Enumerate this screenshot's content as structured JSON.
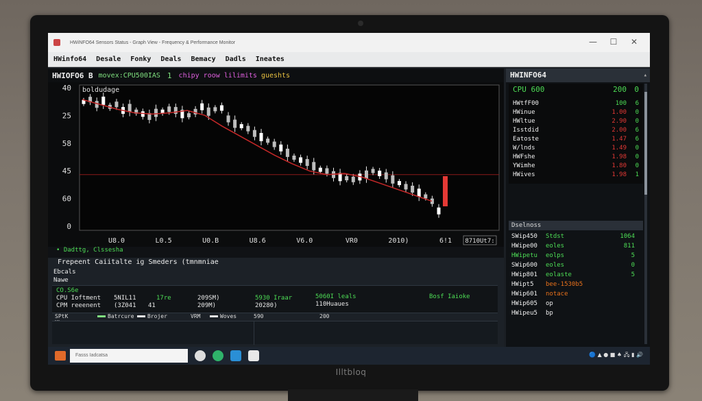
{
  "window": {
    "title": "HWiNFO64 Sensors Status - Graph View - Frequency & Performance Monitor",
    "controls": [
      "—",
      "☐",
      "✕"
    ]
  },
  "menu": [
    "HWinfo64",
    "Desale",
    "Fonky",
    "Deals",
    "Bemacy",
    "Dadls",
    "Ineates"
  ],
  "chart_header": {
    "title": "HWIOFO6 B",
    "legend": "movex:CPU500IAS",
    "count": "1",
    "series_m": "chipy roow lilimits",
    "series_y": "gueshts"
  },
  "chart_data": {
    "type": "line",
    "title": "",
    "ylabel": "",
    "xlabel": "",
    "inner_label": "boldudage",
    "y_ticks": [
      "40",
      "25",
      "58",
      "45",
      "60",
      "0"
    ],
    "x_ticks": [
      "U8.0",
      "L0.5",
      "U0.B",
      "U8.6",
      "V6.0",
      "VR0",
      "2010)",
      "6!1"
    ],
    "cursor_value": "8710Ut7:",
    "ylim": [
      0,
      6
    ],
    "reference_level": 2.3,
    "series": [
      {
        "name": "",
        "type": "candlestick",
        "color": "#e8e8e8",
        "values": [
          5.3,
          5.4,
          5.2,
          5.35,
          5.1,
          5.2,
          4.95,
          5.05,
          4.9,
          4.8,
          4.7,
          4.85,
          4.9,
          5.0,
          4.95,
          4.8,
          4.75,
          4.9,
          5.1,
          4.9,
          5.0,
          5.05,
          4.6,
          4.4,
          4.3,
          4.2,
          4.0,
          3.85,
          3.7,
          3.55,
          3.4,
          3.2,
          3.0,
          2.9,
          2.8,
          2.65,
          2.5,
          2.45,
          2.3,
          2.2,
          2.15,
          2.1,
          2.2,
          2.3,
          2.45,
          2.35,
          2.25,
          2.1,
          1.95,
          1.8,
          1.7,
          1.55,
          1.4,
          1.2,
          0.8
        ]
      },
      {
        "name": "",
        "type": "line",
        "color": "#c62828",
        "values": [
          5.4,
          5.2,
          5.0,
          4.85,
          4.8,
          4.85,
          4.95,
          4.75,
          4.3,
          3.9,
          3.5,
          3.1,
          2.75,
          2.45,
          2.3,
          2.35,
          2.2,
          1.95,
          1.7,
          1.45,
          1.2
        ]
      }
    ],
    "marker_value": 1.5,
    "grid": false,
    "legend": "bottom-left"
  },
  "chart_legend": "• Dadttg, Clssesha",
  "bottom_panel": {
    "title": "Frepeent Caiitalte ig Smeders (tmnmniae",
    "row1": "Ebcals",
    "row2": "Nawe",
    "cells": [
      {
        "text": "CO.S6e",
        "tone": "green"
      },
      {
        "text": "CPU Ioftment",
        "tone": "white"
      },
      {
        "text": "CPM reeenent",
        "tone": "white"
      },
      {
        "text": "5NIL11",
        "tone": "white"
      },
      {
        "text": "(3Z041",
        "tone": "white"
      },
      {
        "text": "17re",
        "tone": "green"
      },
      {
        "text": "41",
        "tone": "white"
      },
      {
        "text": "209SM)",
        "tone": "white"
      },
      {
        "text": "209M)",
        "tone": "white"
      },
      {
        "text": "5930 Iraar",
        "tone": "green"
      },
      {
        "text": "20280)",
        "tone": "white"
      },
      {
        "text": "5060I leals",
        "tone": "green"
      },
      {
        "text": "110Huaues",
        "tone": "white"
      },
      {
        "text": "Bosf Iaioke",
        "tone": "green"
      }
    ],
    "legend": [
      {
        "text": "SPtK Ubo",
        "swatch": ""
      },
      {
        "text": "Batrcure",
        "swatch": "#7fe07f"
      },
      {
        "text": "Brojer",
        "swatch": "#e8e8e8"
      },
      {
        "text": "VRM",
        "swatch": ""
      },
      {
        "text": "Woves",
        "swatch": "#e8e8e8"
      },
      {
        "text": "590",
        "swatch": ""
      },
      {
        "text": "200",
        "swatch": ""
      }
    ]
  },
  "right_panel": {
    "title": "HWINFO64",
    "sensors": [
      {
        "label": "CPU 600",
        "value": "200",
        "status": "0",
        "value_color": "#4ddd55",
        "big": true
      },
      {
        "label": "HWtfF00",
        "value": "100",
        "status": "6",
        "value_color": "#4ddd55"
      },
      {
        "label": "HWinue",
        "value": "1.00",
        "status": "0",
        "value_color": "#e53935"
      },
      {
        "label": "HWltue",
        "value": "2.90",
        "status": "0",
        "value_color": "#e53935"
      },
      {
        "label": "Isstdid",
        "value": "2.00",
        "status": "6",
        "value_color": "#e53935"
      },
      {
        "label": "Eatoste",
        "value": "1.47",
        "status": "6",
        "value_color": "#e53935"
      },
      {
        "label": "W/lnds",
        "value": "1.49",
        "status": "0",
        "value_color": "#e53935"
      },
      {
        "label": "HWFshe",
        "value": "1.98",
        "status": "0",
        "value_color": "#e53935"
      },
      {
        "label": "YWimhe",
        "value": "1.80",
        "status": "0",
        "value_color": "#e53935"
      },
      {
        "label": "HWives",
        "value": "1.98",
        "status": "1",
        "value_color": "#e53935"
      }
    ],
    "section": "Dselnoss",
    "rows": [
      {
        "label": "SWip450",
        "mid": "Stdst",
        "mid_color": "#4ddd55",
        "value": "1064"
      },
      {
        "label": "HWipe00",
        "mid": "eoles",
        "mid_color": "#4ddd55",
        "value": "811"
      },
      {
        "label": "HWipetu",
        "mid": "eolps",
        "mid_color": "#4ddd55",
        "value": "5"
      },
      {
        "label": "SWip600",
        "mid": "eoles",
        "mid_color": "#4ddd55",
        "value": "0"
      },
      {
        "label": "HWip801",
        "mid": "eolaste",
        "mid_color": "#4ddd55",
        "value": "5"
      },
      {
        "label": "HWipt5",
        "mid": "bee-1530b5",
        "mid_color": "#e8711b",
        "value": ""
      },
      {
        "label": "HWip601",
        "mid": "notace",
        "mid_color": "#e8711b",
        "value": ""
      },
      {
        "label": "HWip605",
        "mid": "op",
        "mid_color": "#e8e8e8",
        "value": ""
      },
      {
        "label": "HWipeu5",
        "mid": "bp",
        "mid_color": "#e8e8e8",
        "value": ""
      }
    ]
  },
  "taskbar": {
    "search_placeholder": "Fasss Iadcatsa",
    "icons": [
      "search-icon",
      "edge-icon",
      "explorer-icon",
      "store-icon"
    ],
    "tray": "🔵 ▲ ● ■ ♠ 🖧 ▮ 🔊"
  },
  "monitor_brand": "Illtbloq"
}
